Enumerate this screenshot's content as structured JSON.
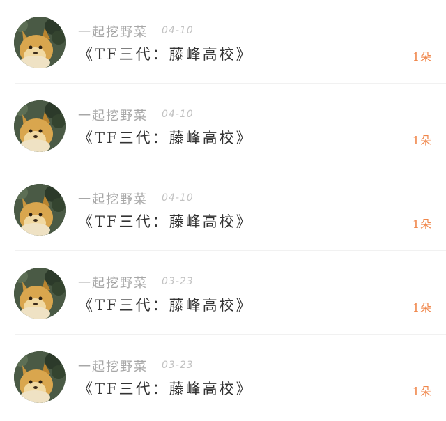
{
  "colors": {
    "username": "#a7a7a7",
    "date": "#c2c2c2",
    "title": "#333333",
    "count": "#f0864a",
    "divider": "#f1f1f1"
  },
  "items": [
    {
      "username": "一起挖野菜",
      "date": "04-10",
      "title": "《TF三代：藤峰高校》",
      "count": "1朵",
      "avatar_icon": "dog-avatar-icon"
    },
    {
      "username": "一起挖野菜",
      "date": "04-10",
      "title": "《TF三代：藤峰高校》",
      "count": "1朵",
      "avatar_icon": "dog-avatar-icon"
    },
    {
      "username": "一起挖野菜",
      "date": "04-10",
      "title": "《TF三代：藤峰高校》",
      "count": "1朵",
      "avatar_icon": "dog-avatar-icon"
    },
    {
      "username": "一起挖野菜",
      "date": "03-23",
      "title": "《TF三代：藤峰高校》",
      "count": "1朵",
      "avatar_icon": "dog-avatar-icon"
    },
    {
      "username": "一起挖野菜",
      "date": "03-23",
      "title": "《TF三代：藤峰高校》",
      "count": "1朵",
      "avatar_icon": "dog-avatar-icon"
    }
  ]
}
